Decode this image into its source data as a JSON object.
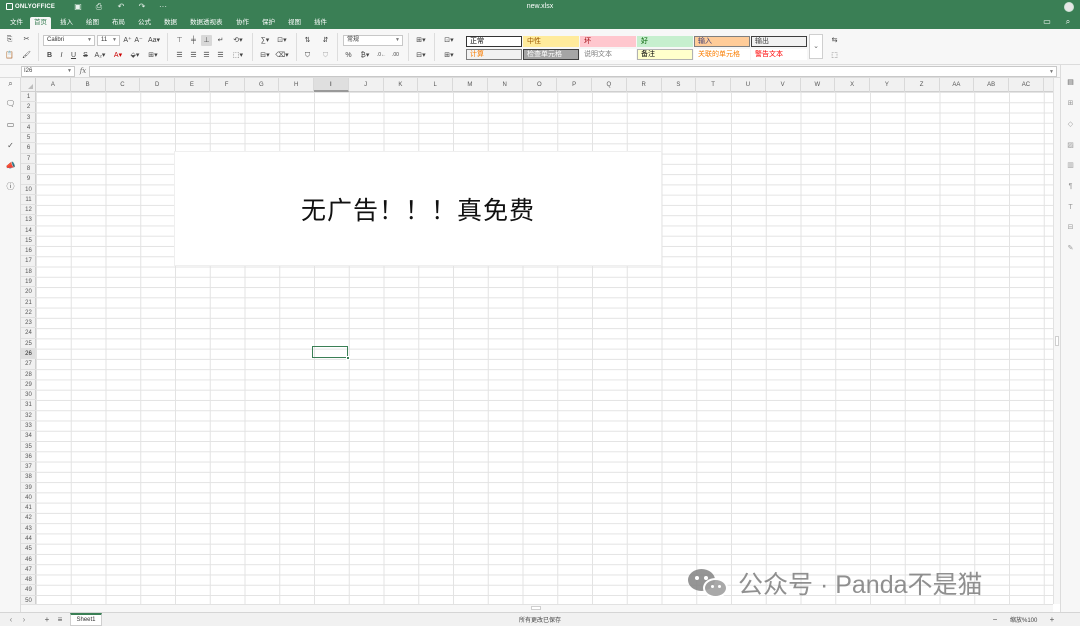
{
  "app": {
    "logo": "ONLYOFFICE",
    "filename": "new.xlsx",
    "accent": "#3a7f55"
  },
  "quick_access": {
    "more": "···"
  },
  "menu": {
    "tabs": [
      {
        "label": "文件"
      },
      {
        "label": "首页"
      },
      {
        "label": "插入"
      },
      {
        "label": "绘图"
      },
      {
        "label": "布局"
      },
      {
        "label": "公式"
      },
      {
        "label": "数据"
      },
      {
        "label": "数据透视表"
      },
      {
        "label": "协作"
      },
      {
        "label": "保护"
      },
      {
        "label": "视图"
      },
      {
        "label": "插件"
      }
    ],
    "active": "首页"
  },
  "toolbar": {
    "font_name": "Calibri",
    "font_size": "11",
    "number_format": "常规",
    "styles": [
      {
        "label": "正常",
        "bg": "#ffffff",
        "fg": "#000000",
        "border": "#333333"
      },
      {
        "label": "中性",
        "bg": "#ffeb9c",
        "fg": "#9c5700",
        "border": "#ffeb9c"
      },
      {
        "label": "坏",
        "bg": "#ffc7ce",
        "fg": "#9c0006",
        "border": "#ffc7ce"
      },
      {
        "label": "好",
        "bg": "#c6efce",
        "fg": "#006100",
        "border": "#c6efce"
      },
      {
        "label": "输入",
        "bg": "#ffcc99",
        "fg": "#3f3f76",
        "border": "#7f7f7f"
      },
      {
        "label": "输出",
        "bg": "#f2f2f2",
        "fg": "#3f3f3f",
        "border": "#3f3f3f"
      },
      {
        "label": "计算",
        "bg": "#f2f2f2",
        "fg": "#fa7d00",
        "border": "#7f7f7f"
      },
      {
        "label": "检查单元格",
        "bg": "#a5a5a5",
        "fg": "#ffffff",
        "border": "#3f3f3f"
      },
      {
        "label": "说明文本",
        "bg": "#ffffff",
        "fg": "#7f7f7f",
        "border": "#ffffff"
      },
      {
        "label": "备注",
        "bg": "#ffffcc",
        "fg": "#000000",
        "border": "#b2b2b2"
      },
      {
        "label": "关联的单元格",
        "bg": "#ffffff",
        "fg": "#fa7d00",
        "border": "#ffffff"
      },
      {
        "label": "警告文本",
        "bg": "#ffffff",
        "fg": "#ff0000",
        "border": "#ffffff"
      }
    ]
  },
  "formula_bar": {
    "cell_ref": "I26",
    "fx": "fx",
    "value": ""
  },
  "grid": {
    "columns": [
      "A",
      "B",
      "C",
      "D",
      "E",
      "F",
      "G",
      "H",
      "I",
      "J",
      "K",
      "L",
      "M",
      "N",
      "O",
      "P",
      "Q",
      "R",
      "S",
      "T",
      "U",
      "V",
      "W",
      "X",
      "Y",
      "Z",
      "AA",
      "AB",
      "AC"
    ],
    "rows": [
      "1",
      "2",
      "3",
      "4",
      "5",
      "6",
      "7",
      "8",
      "9",
      "10",
      "11",
      "12",
      "13",
      "14",
      "15",
      "16",
      "17",
      "18",
      "19",
      "20",
      "21",
      "22",
      "23",
      "24",
      "25",
      "26",
      "27",
      "28",
      "29",
      "30",
      "31",
      "32",
      "33",
      "34",
      "35",
      "36",
      "37",
      "38",
      "39",
      "40",
      "41",
      "42",
      "43",
      "44",
      "45",
      "46",
      "47",
      "48",
      "49",
      "50"
    ],
    "selected_column": "I",
    "selected_row": "26"
  },
  "textbox": {
    "text": "无广告！！！真免费"
  },
  "status": {
    "sheet_tab": "Sheet1",
    "saved": "所有更改已保存",
    "zoom": "缩放%100"
  },
  "watermark": {
    "text": "公众号 · Panda不是猫"
  }
}
